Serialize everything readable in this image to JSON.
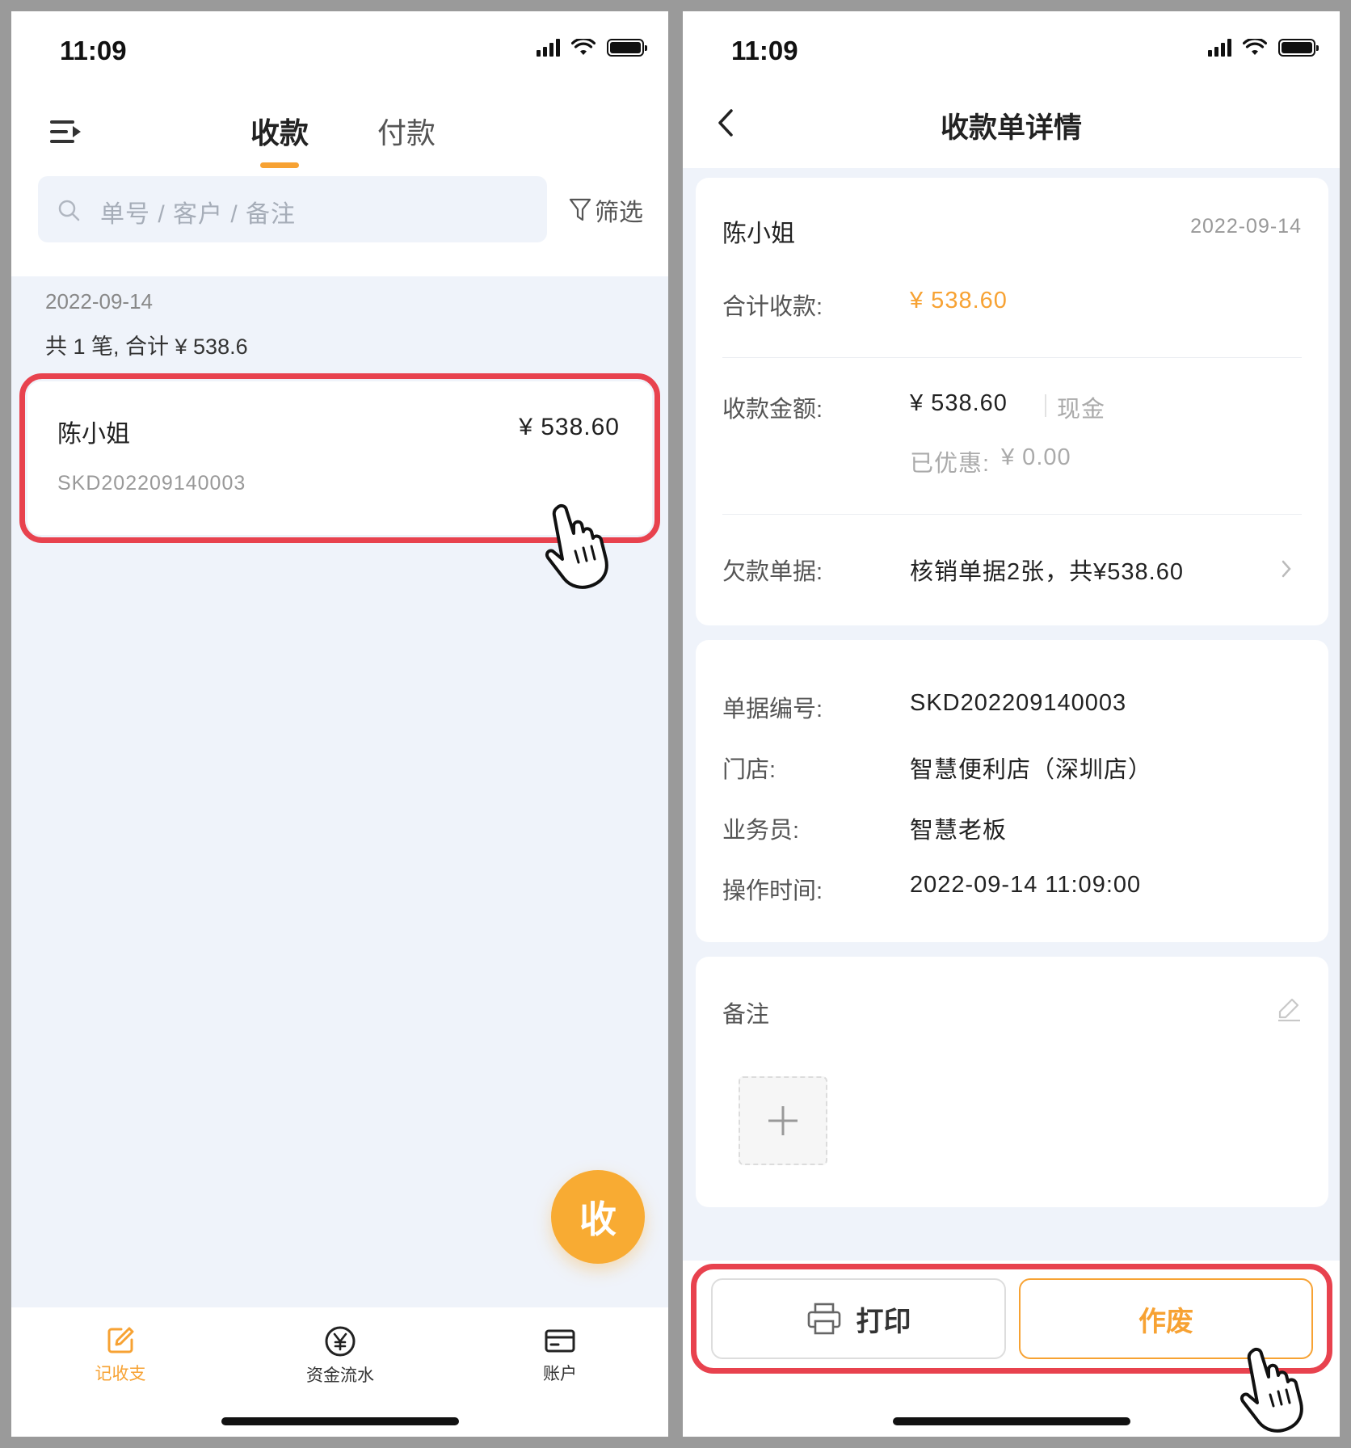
{
  "left": {
    "status": {
      "time": "11:09"
    },
    "tabs": [
      {
        "label": "收款",
        "active": true
      },
      {
        "label": "付款",
        "active": false
      }
    ],
    "search": {
      "placeholder": "单号 / 客户 / 备注"
    },
    "filter_label": "筛选",
    "group": {
      "date": "2022-09-14",
      "summary": "共 1 笔, 合计 ¥ 538.6"
    },
    "order": {
      "customer": "陈小姐",
      "amount": "¥ 538.60",
      "number": "SKD202209140003"
    },
    "fab_label": "收",
    "nav": [
      {
        "label": "记收支",
        "icon": "edit-icon",
        "active": true
      },
      {
        "label": "资金流水",
        "icon": "yen-circle-icon",
        "active": false
      },
      {
        "label": "账户",
        "icon": "card-icon",
        "active": false
      }
    ]
  },
  "right": {
    "status": {
      "time": "11:09"
    },
    "title": "收款单详情",
    "summary": {
      "customer": "陈小姐",
      "date": "2022-09-14",
      "total_label": "合计收款:",
      "total_value": "¥ 538.60",
      "received_label": "收款金额:",
      "received_value": "¥ 538.60",
      "method": "现金",
      "discount_label": "已优惠:",
      "discount_value": "¥ 0.00",
      "debt_label": "欠款单据:",
      "debt_value": "核销单据2张，共¥538.60"
    },
    "details": [
      {
        "label": "单据编号:",
        "value": "SKD202209140003"
      },
      {
        "label": "门店:",
        "value": "智慧便利店（深圳店）"
      },
      {
        "label": "业务员:",
        "value": "智慧老板"
      },
      {
        "label": "操作时间:",
        "value": "2022-09-14 11:09:00"
      }
    ],
    "remark_label": "备注",
    "buttons": {
      "print": "打印",
      "void": "作废"
    }
  },
  "colors": {
    "accent": "#f7a233",
    "highlight": "#e8424e",
    "background": "#eff3fa"
  }
}
